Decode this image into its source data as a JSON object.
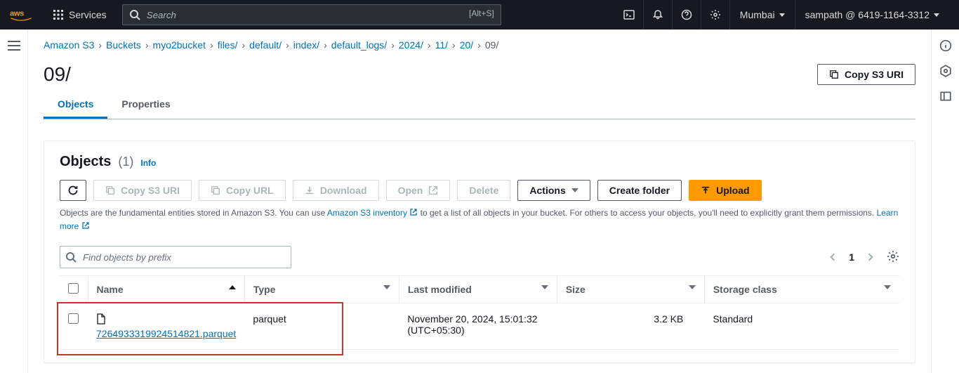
{
  "topnav": {
    "services_label": "Services",
    "search_placeholder": "Search",
    "search_shortcut": "[Alt+S]",
    "region": "Mumbai",
    "account": "sampath @ 6419-1164-3312"
  },
  "breadcrumbs": [
    {
      "label": "Amazon S3",
      "link": true
    },
    {
      "label": "Buckets",
      "link": true
    },
    {
      "label": "myo2bucket",
      "link": true
    },
    {
      "label": "files/",
      "link": true
    },
    {
      "label": "default/",
      "link": true
    },
    {
      "label": "index/",
      "link": true
    },
    {
      "label": "default_logs/",
      "link": true
    },
    {
      "label": "2024/",
      "link": true
    },
    {
      "label": "11/",
      "link": true
    },
    {
      "label": "20/",
      "link": true
    },
    {
      "label": "09/",
      "link": false
    }
  ],
  "page": {
    "title": "09/",
    "copy_uri_label": "Copy S3 URI"
  },
  "tabs": {
    "objects": "Objects",
    "properties": "Properties"
  },
  "panel": {
    "title": "Objects",
    "count": "(1)",
    "info": "Info",
    "refresh": "",
    "copy_s3_uri": "Copy S3 URI",
    "copy_url": "Copy URL",
    "download": "Download",
    "open": "Open",
    "delete": "Delete",
    "actions": "Actions",
    "create_folder": "Create folder",
    "upload": "Upload",
    "desc_1": "Objects are the fundamental entities stored in Amazon S3. You can use ",
    "desc_inv": "Amazon S3 inventory",
    "desc_2": " to get a list of all objects in your bucket. For others to access your objects, you'll need to explicitly grant them permissions. ",
    "learn_more": "Learn more",
    "filter_placeholder": "Find objects by prefix",
    "page_num": "1"
  },
  "table": {
    "headers": {
      "name": "Name",
      "type": "Type",
      "last_modified": "Last modified",
      "size": "Size",
      "storage_class": "Storage class"
    },
    "rows": [
      {
        "name": "7264933319924514821.parquet",
        "type": "parquet",
        "last_modified": "November 20, 2024, 15:01:32 (UTC+05:30)",
        "size": "3.2 KB",
        "storage_class": "Standard"
      }
    ]
  }
}
